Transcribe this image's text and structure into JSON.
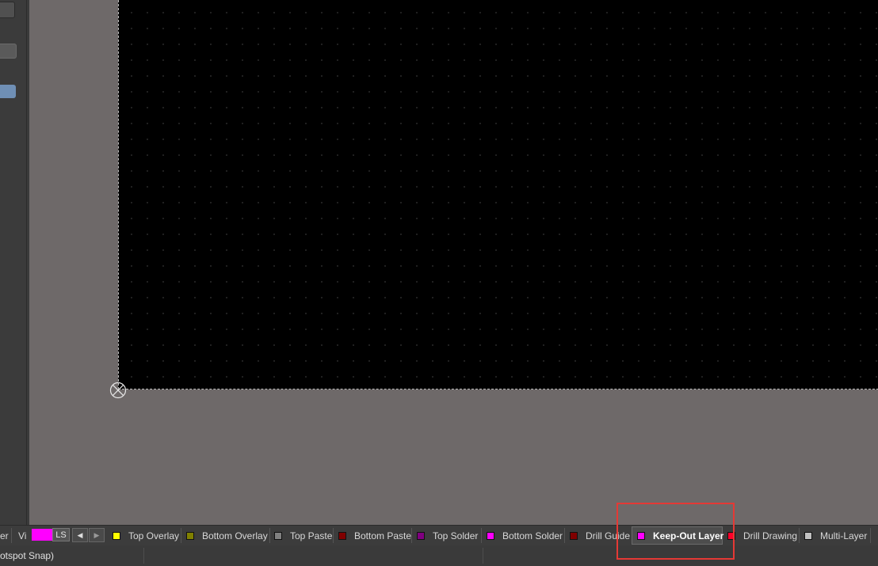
{
  "layer_bar": {
    "partial_left": "er",
    "vi_label": "Vi",
    "ls_label": "LS",
    "prev_icon": "◀",
    "next_icon": "▶",
    "layers": [
      {
        "name": "Top Overlay",
        "color": "#ffff00"
      },
      {
        "name": "Bottom Overlay",
        "color": "#808000"
      },
      {
        "name": "Top Paste",
        "color": "#808080"
      },
      {
        "name": "Bottom Paste",
        "color": "#800000"
      },
      {
        "name": "Top Solder",
        "color": "#800080"
      },
      {
        "name": "Bottom Solder",
        "color": "#ff00ff"
      },
      {
        "name": "Drill Guide",
        "color": "#800000"
      },
      {
        "name": "Keep-Out Layer",
        "color": "#ff00ff",
        "active": true
      },
      {
        "name": "Drill Drawing",
        "color": "#ff002a"
      },
      {
        "name": "Multi-Layer",
        "color": "#c0c0c0"
      }
    ]
  },
  "status_bar": {
    "text": "otspot Snap)"
  },
  "colors": {
    "workspace_bg": "#6e6969",
    "board_bg": "#000000",
    "highlight": "#e53935",
    "ls_swatch": "#ff00ff"
  }
}
